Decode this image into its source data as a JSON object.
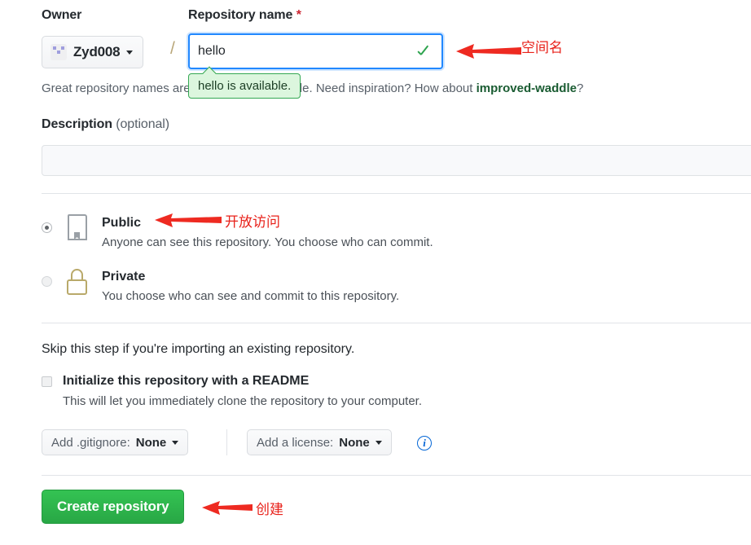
{
  "form": {
    "owner": {
      "label": "Owner",
      "name": "Zyd008",
      "avatar_icon": "identicon-avatar"
    },
    "separator": "/",
    "repository_name": {
      "label": "Repository name",
      "required_marker": "*",
      "value": "hello",
      "placeholder": "",
      "valid_icon": "check-icon",
      "availability_tooltip": "hello is available."
    },
    "helper": {
      "prefix": "Great repository names are short and memorable. Need inspiration? How about ",
      "suggestion": "improved-waddle",
      "suffix": "?"
    },
    "description": {
      "label": "Description",
      "optional_label": "(optional)",
      "value": "",
      "placeholder": ""
    },
    "visibility": {
      "options": [
        {
          "id": "public",
          "title": "Public",
          "description": "Anyone can see this repository. You choose who can commit.",
          "icon": "repo-book-icon",
          "selected": true
        },
        {
          "id": "private",
          "title": "Private",
          "description": "You choose who can see and commit to this repository.",
          "icon": "lock-icon",
          "selected": false
        }
      ]
    },
    "initialize": {
      "skip_note": "Skip this step if you're importing an existing repository.",
      "readme_label": "Initialize this repository with a README",
      "readme_description": "This will let you immediately clone the repository to your computer.",
      "readme_checked": false,
      "gitignore": {
        "prefix": "Add .gitignore:",
        "value": "None"
      },
      "license": {
        "prefix": "Add a license:",
        "value": "None"
      },
      "info_icon": "info-circle-icon"
    },
    "submit_label": "Create repository"
  },
  "annotations": [
    {
      "id": "repo-name",
      "text": "空间名"
    },
    {
      "id": "public",
      "text": "开放访问"
    },
    {
      "id": "create",
      "text": "创建"
    }
  ],
  "colors": {
    "accent_blue": "#2188ff",
    "success_green": "#2ea44f",
    "button_green": "#28a745",
    "annotation_red": "#e8211a",
    "lock_tan": "#b9a96a",
    "suggestion_green": "#1a5c32"
  }
}
